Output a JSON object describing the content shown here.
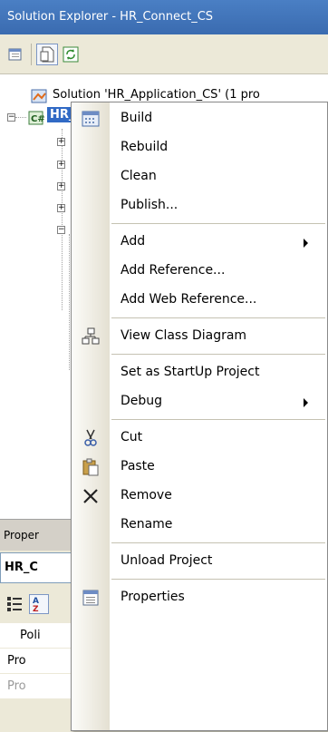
{
  "window": {
    "title": "Solution Explorer - HR_Connect_CS"
  },
  "tree": {
    "solution_label": "Solution 'HR_Application_CS' (1 pro",
    "project_label": "HR_Connect_CS"
  },
  "properties": {
    "title": "Proper",
    "object": "HR_C",
    "rows": [
      "Poli",
      "Pro",
      "Pro"
    ]
  },
  "context_menu": {
    "items": [
      {
        "label": "Build",
        "icon": "build-icon"
      },
      {
        "label": "Rebuild"
      },
      {
        "label": "Clean"
      },
      {
        "label": "Publish..."
      },
      {
        "label": "Add",
        "submenu": true
      },
      {
        "label": "Add Reference..."
      },
      {
        "label": "Add Web Reference..."
      },
      {
        "label": "View Class Diagram",
        "icon": "class-diagram-icon"
      },
      {
        "label": "Set as StartUp Project"
      },
      {
        "label": "Debug",
        "submenu": true
      },
      {
        "label": "Cut",
        "icon": "cut-icon"
      },
      {
        "label": "Paste",
        "icon": "paste-icon"
      },
      {
        "label": "Remove",
        "icon": "remove-icon"
      },
      {
        "label": "Rename"
      },
      {
        "label": "Unload Project"
      },
      {
        "label": "Properties",
        "icon": "properties-icon"
      }
    ]
  },
  "colors": {
    "title_bar": "#3a6bb0",
    "selection": "#316ac5",
    "menu_gutter": "#e4e0d2"
  }
}
